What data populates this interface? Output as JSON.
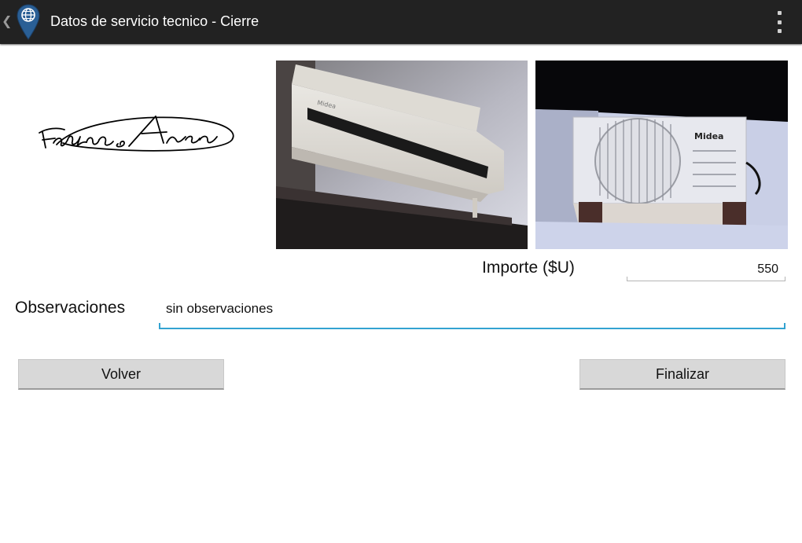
{
  "action_bar": {
    "title": "Datos de servicio tecnico - Cierre",
    "up_icon": "chevron-left-icon",
    "app_icon": "globe-location-pin-icon",
    "overflow_icon": "overflow-menu-icon"
  },
  "signature": {
    "icon": "signature-image"
  },
  "photos": [
    {
      "subject": "indoor-split-ac-unit",
      "brand": "Midea"
    },
    {
      "subject": "outdoor-ac-condenser-unit",
      "brand": "Midea"
    }
  ],
  "importe": {
    "label": "Importe ($U)",
    "value": "550"
  },
  "observaciones": {
    "label": "Observaciones",
    "value": "sin observaciones"
  },
  "buttons": {
    "back": "Volver",
    "finish": "Finalizar"
  },
  "colors": {
    "action_bar": "#222222",
    "focus_accent": "#33a3d1",
    "button_bg": "#d8d8d8"
  }
}
